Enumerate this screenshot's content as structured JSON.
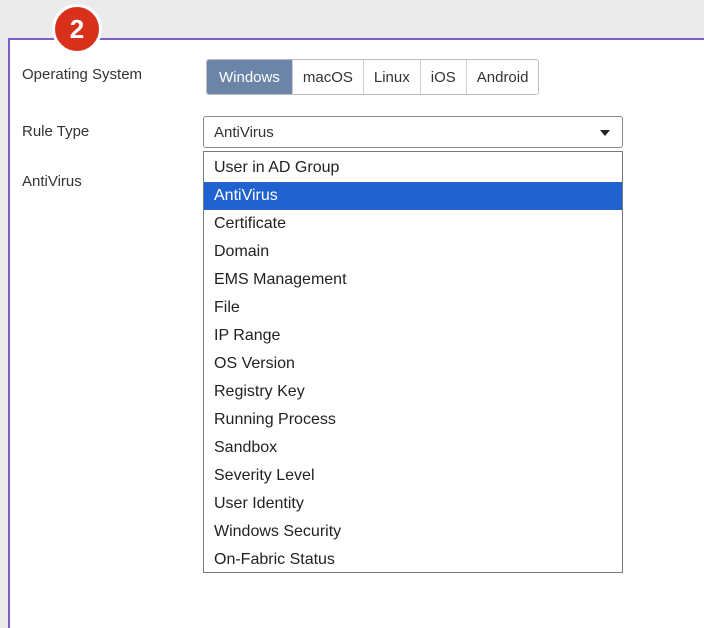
{
  "step_badge": "2",
  "form": {
    "os_label": "Operating System",
    "os_options": [
      "Windows",
      "macOS",
      "Linux",
      "iOS",
      "Android"
    ],
    "os_selected": "Windows",
    "rule_type_label": "Rule Type",
    "rule_type_value": "AntiVirus",
    "section_label": "AntiVirus"
  },
  "dropdown": {
    "options": [
      "User in AD Group",
      "AntiVirus",
      "Certificate",
      "Domain",
      "EMS Management",
      "File",
      "IP Range",
      "OS Version",
      "Registry Key",
      "Running Process",
      "Sandbox",
      "Severity Level",
      "User Identity",
      "Windows Security",
      "On-Fabric Status"
    ],
    "selected": "AntiVirus"
  },
  "colors": {
    "accent_border": "#7b5fc9",
    "badge": "#d9301c",
    "segment_active": "#6b85a8",
    "option_selected": "#1f62d0"
  }
}
